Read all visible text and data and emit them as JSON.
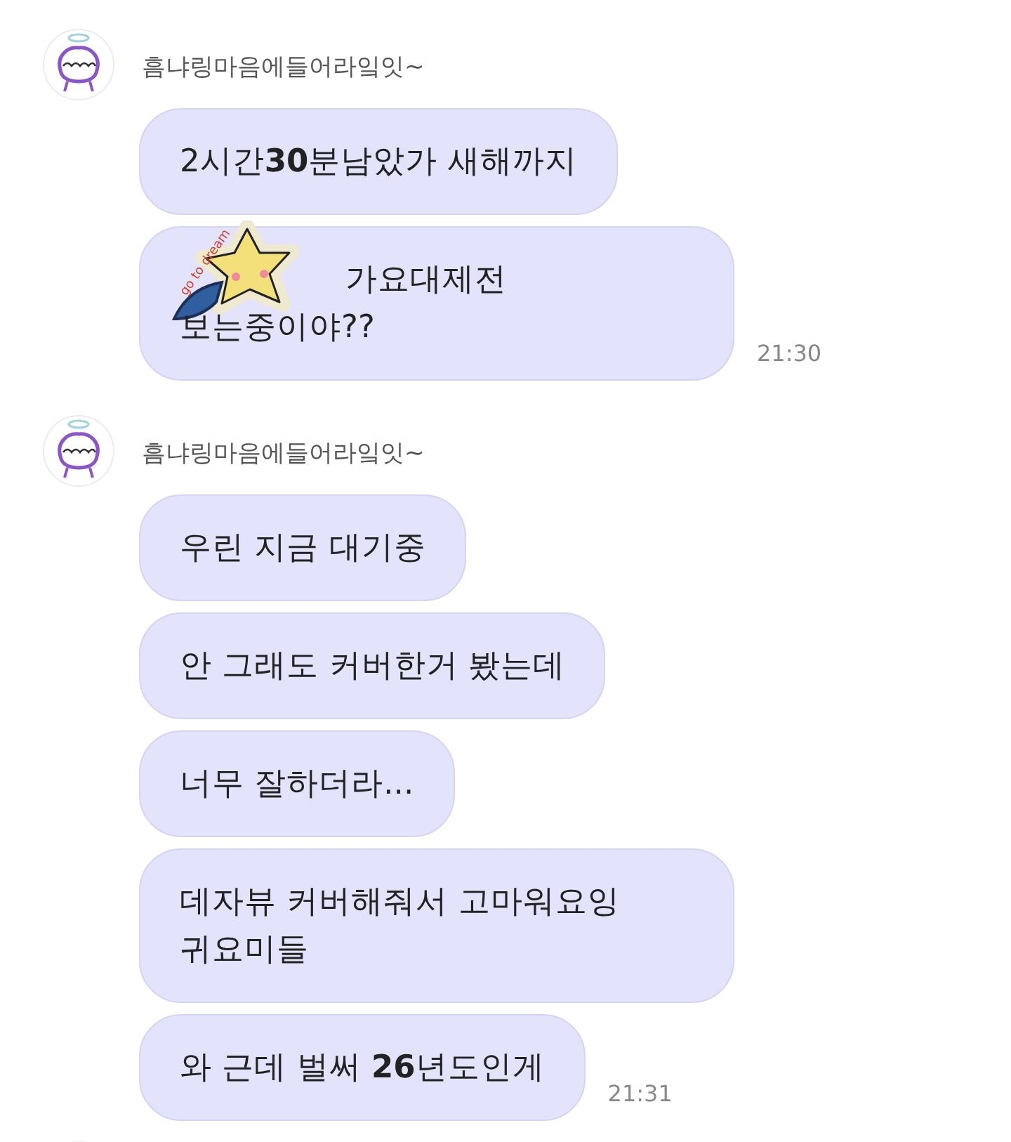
{
  "groups": [
    {
      "kind": "messages",
      "sender": "흠냐링마음에들어라잌잇~",
      "messages": [
        {
          "lines": [
            "2시간**30**분남았가 새해까지"
          ]
        },
        {
          "lines": [
            "가요대제전",
            "보는중이야??"
          ],
          "sticker": {
            "text": "go to dream"
          },
          "time": "21:30"
        }
      ]
    },
    {
      "kind": "messages",
      "sender": "흠냐링마음에들어라잌잇~",
      "messages": [
        {
          "lines": [
            "우린 지금 대기중"
          ]
        },
        {
          "lines": [
            "안 그래도 커버한거 봤는데"
          ]
        },
        {
          "lines": [
            "너무 잘하더라..."
          ]
        },
        {
          "lines": [
            "데자뷰 커버해줘서 고마워요잉",
            "귀요미들"
          ]
        },
        {
          "lines": [
            "와 근데 벌써 **26**년도인게"
          ],
          "time": "21:31"
        }
      ]
    },
    {
      "kind": "cut_off"
    }
  ]
}
